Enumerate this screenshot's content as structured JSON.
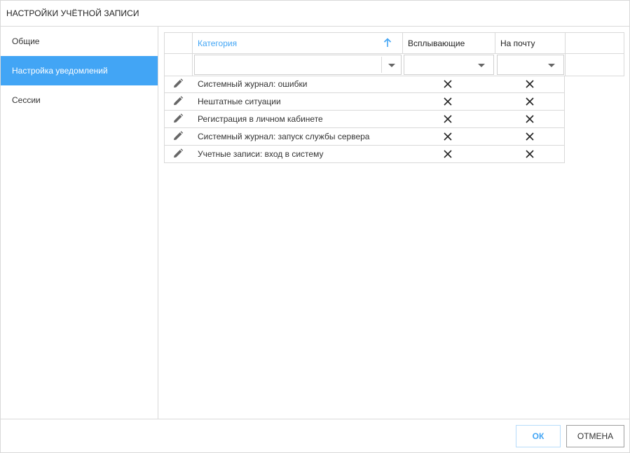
{
  "dialog": {
    "title": "НАСТРОЙКИ УЧЁТНОЙ ЗАПИСИ"
  },
  "sidebar": {
    "items": [
      {
        "label": "Общие",
        "active": false
      },
      {
        "label": "Настройка уведомлений",
        "active": true
      },
      {
        "label": "Сессии",
        "active": false
      }
    ]
  },
  "grid": {
    "columns": {
      "category": "Категория",
      "popup": "Всплывающие",
      "email": "На почту"
    },
    "sort": {
      "column": "category",
      "direction": "ascending",
      "icon": "arrow-up-icon"
    },
    "rows": [
      {
        "category": "Системный журнал: ошибки",
        "popup": false,
        "email": false
      },
      {
        "category": "Нештатные ситуации",
        "popup": false,
        "email": false
      },
      {
        "category": "Регистрация в личном кабинете",
        "popup": false,
        "email": false
      },
      {
        "category": "Системный журнал: запуск службы сервера",
        "popup": false,
        "email": false
      },
      {
        "category": "Учетные записи: вход в систему",
        "popup": false,
        "email": false
      }
    ]
  },
  "footer": {
    "ok_label": "ОК",
    "cancel_label": "ОТМЕНА"
  },
  "colors": {
    "accent": "#42a5f5",
    "border": "#d9d9d9",
    "text": "#333333"
  }
}
